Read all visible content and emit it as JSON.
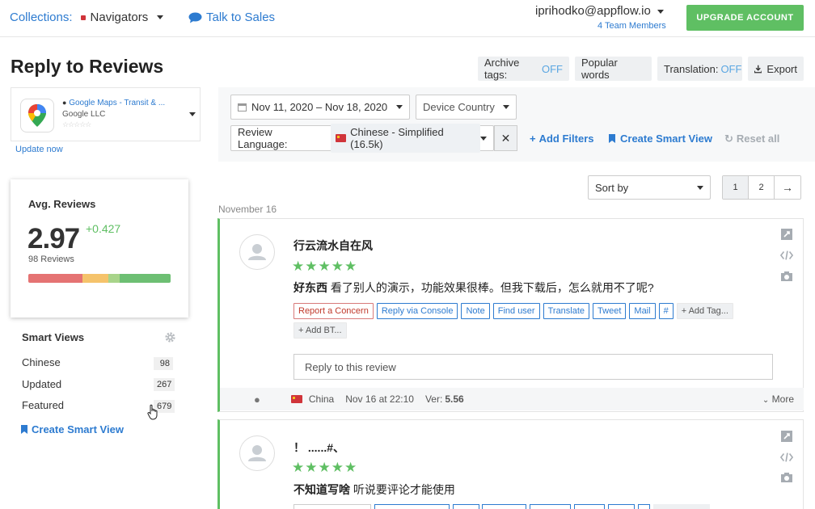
{
  "topbar": {
    "collections_label": "Collections:",
    "collection_name": "Navigators",
    "talk_to_sales": "Talk to Sales",
    "user_email": "iprihodko@appflow.io",
    "team_members": "4 Team Members",
    "upgrade_label": "UPGRADE ACCOUNT"
  },
  "page": {
    "title": "Reply to Reviews"
  },
  "toolbar": {
    "archive_tags_label": "Archive tags:",
    "archive_tags_state": "OFF",
    "popular_words": "Popular words",
    "translation_label": "Translation:",
    "translation_state": "OFF",
    "export": "Export"
  },
  "app": {
    "name": "Google Maps - Transit & ...",
    "developer": "Google LLC",
    "stars": "☆☆☆☆☆",
    "update_now": "Update now"
  },
  "avg_reviews": {
    "title": "Avg. Reviews",
    "value": "2.97",
    "delta": "+0.427",
    "count": "98 Reviews",
    "distribution": [
      {
        "share": 0.38,
        "color": "#e57373"
      },
      {
        "share": 0.18,
        "color": "#f5c36b"
      },
      {
        "share": 0.08,
        "color": "#a8d48a"
      },
      {
        "share": 0.36,
        "color": "#6dbf73"
      }
    ]
  },
  "smart_views": {
    "title": "Smart Views",
    "items": [
      {
        "label": "Chinese",
        "count": "98"
      },
      {
        "label": "Updated",
        "count": "267"
      },
      {
        "label": "Featured",
        "count": "679"
      }
    ],
    "create_label": "Create Smart View"
  },
  "filters": {
    "date_range": "Nov 11, 2020 – Nov 18, 2020",
    "country_placeholder": "Device Country",
    "language_label": "Review Language:",
    "language_value": "Chinese - Simplified (16.5k)",
    "add_filters": "Add Filters",
    "create_smart_view": "Create Smart View",
    "reset_all": "Reset all"
  },
  "sorting": {
    "sort_by": "Sort by",
    "pages": [
      "1",
      "2"
    ],
    "next_arrow": "→"
  },
  "date_group": "November 16",
  "reviews": [
    {
      "title": "行云流水自在风",
      "stars": "★★★★★",
      "text_bold": "好东西",
      "text": " 看了别人的演示，功能效果很棒。但我下载后，怎么就用不了呢?",
      "actions": [
        "Report a Concern",
        "Reply via Console",
        "Note",
        "Find user",
        "Translate",
        "Tweet",
        "Mail",
        "#",
        "+ Add Tag...",
        "+ Add BT..."
      ],
      "reply_placeholder": "Reply to this review",
      "country": "China",
      "date": "Nov 16 at 22:10",
      "version_label": "Ver:",
      "version": "5.56",
      "more": "More"
    },
    {
      "title": "！ ......#、",
      "stars": "★★★★★",
      "text_bold": "不知道写啥",
      "text": " 听说要评论才能使用"
    }
  ],
  "colors": {
    "accent": "#2d7bd0",
    "success": "#5fbf63",
    "off_state": "#5aa6e2"
  }
}
